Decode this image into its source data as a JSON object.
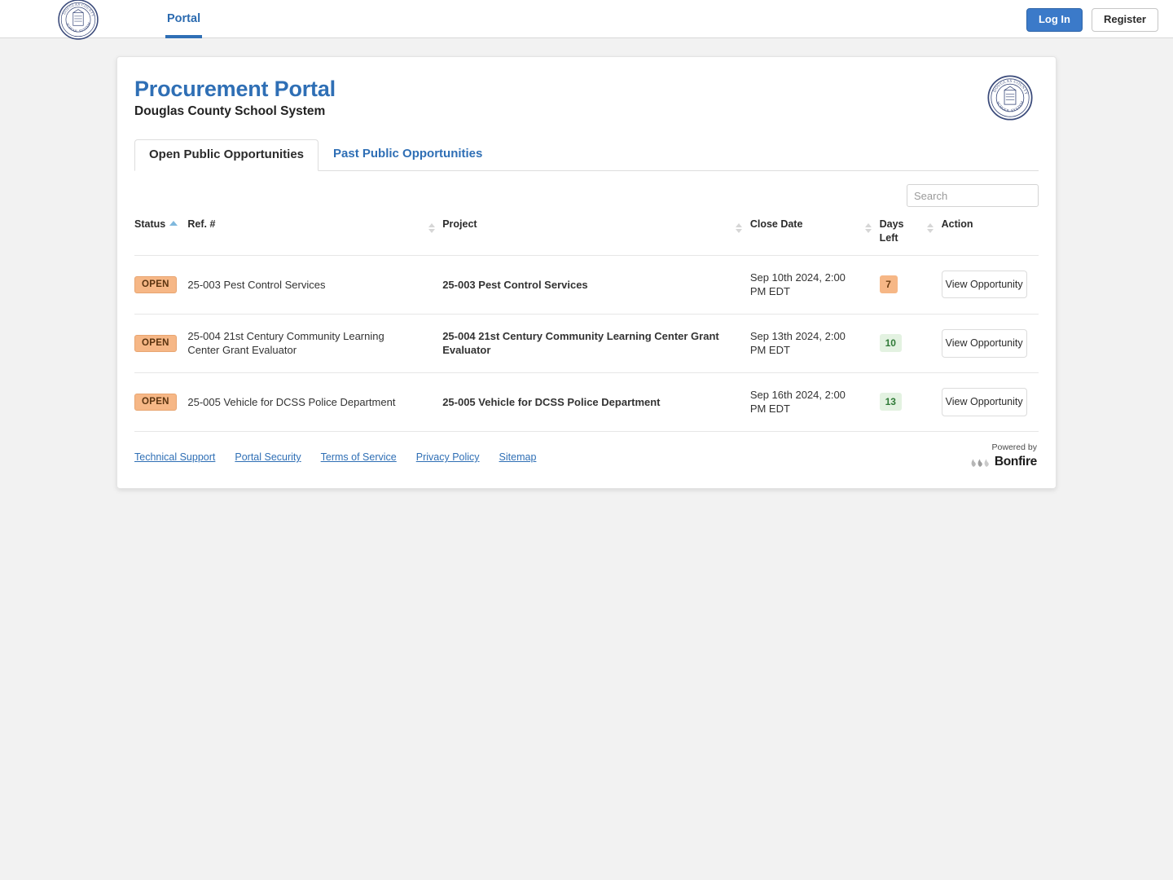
{
  "navbar": {
    "logo_alt": "Douglas County School System seal",
    "tab_portal": "Portal",
    "login_label": "Log In",
    "register_label": "Register"
  },
  "header": {
    "title": "Procurement Portal",
    "subtitle": "Douglas County School System",
    "logo_alt": "Douglas County School System seal"
  },
  "tabs": [
    {
      "label": "Open Public Opportunities",
      "active": true
    },
    {
      "label": "Past Public Opportunities",
      "active": false
    }
  ],
  "search": {
    "placeholder": "Search",
    "value": ""
  },
  "table": {
    "columns": {
      "status": "Status",
      "ref": "Ref. #",
      "project": "Project",
      "close_date": "Close Date",
      "days_left": "Days Left",
      "action": "Action"
    },
    "sorted_by": "Status",
    "sort_direction": "asc",
    "rows": [
      {
        "status": "OPEN",
        "ref": "25-003 Pest Control Services",
        "project": "25-003 Pest Control Services",
        "close_date": "Sep 10th 2024, 2:00 PM EDT",
        "days_left": "7",
        "days_left_tone": "orange",
        "action": "View Opportunity"
      },
      {
        "status": "OPEN",
        "ref": "25-004 21st Century Community Learning Center Grant Evaluator",
        "project": "25-004 21st Century Community Learning Center Grant Evaluator",
        "close_date": "Sep 13th 2024, 2:00 PM EDT",
        "days_left": "10",
        "days_left_tone": "green",
        "action": "View Opportunity"
      },
      {
        "status": "OPEN",
        "ref": "25-005 Vehicle for DCSS Police Department",
        "project": "25-005 Vehicle for DCSS Police Department",
        "close_date": "Sep 16th 2024, 2:00 PM EDT",
        "days_left": "13",
        "days_left_tone": "green",
        "action": "View Opportunity"
      }
    ]
  },
  "footer": {
    "links": [
      "Technical Support",
      "Portal Security",
      "Terms of Service",
      "Privacy Policy",
      "Sitemap"
    ],
    "powered_by_label": "Powered by",
    "powered_by_brand": "Bonfire"
  },
  "colors": {
    "accent_blue": "#2f6fb5",
    "button_blue": "#3b7ac9",
    "badge_orange": "#f6b786",
    "badge_green": "#e3f2e1",
    "page_background": "#f2f2f2"
  }
}
